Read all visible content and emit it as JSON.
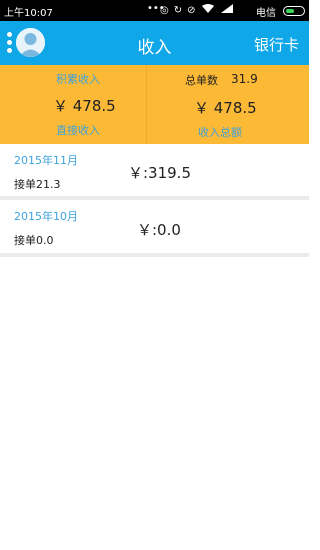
{
  "status_bar": {
    "time": "上午10:07",
    "dots": "•••",
    "carrier": "电信",
    "icons": [
      "alarm-icon",
      "sync-icon",
      "mute-icon",
      "wifi-icon",
      "signal-icon"
    ]
  },
  "app_bar": {
    "title": "收入",
    "bank_card_label": "银行卡"
  },
  "summary": {
    "left": {
      "label_top": "积累收入",
      "amount": "￥ 478.5",
      "label_bottom": "直接收入"
    },
    "right": {
      "total_orders_label": "总单数",
      "total_orders_value": "31.9",
      "amount": "￥ 478.5",
      "label_bottom": "收入总额"
    }
  },
  "months": [
    {
      "month": "2015年11月",
      "orders": "接单21.3",
      "amount": "￥:319.5"
    },
    {
      "month": "2015年10月",
      "orders": "接单0.0",
      "amount": "￥:0.0"
    }
  ],
  "colors": {
    "app_bar": "#10a7e8",
    "summary_bg": "#fbb935",
    "label_blue": "#3ea3dc",
    "battery_green": "#3dd65c"
  }
}
